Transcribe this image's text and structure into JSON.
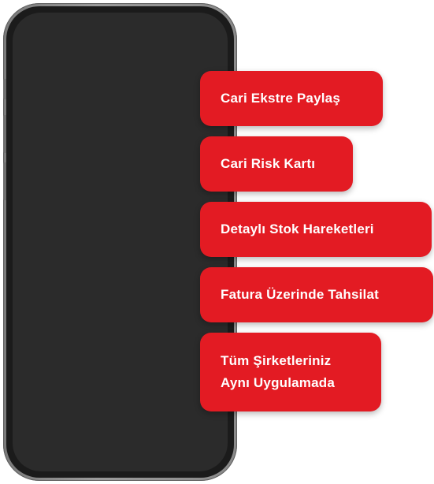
{
  "features": [
    {
      "label": "Cari Ekstre Paylaş"
    },
    {
      "label": "Cari Risk Kartı"
    },
    {
      "label": "Detaylı Stok Hareketleri"
    },
    {
      "label": "Fatura Üzerinde Tahsilat"
    },
    {
      "lines": [
        "Tüm Şirketleriniz",
        "Aynı Uygulamada"
      ]
    }
  ],
  "colors": {
    "accent": "#e31b23",
    "phone_frame": "#8a8a8a",
    "phone_screen": "#2b2b2b"
  }
}
